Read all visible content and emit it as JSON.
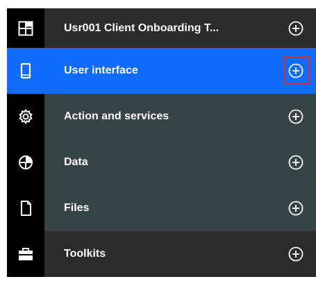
{
  "nav": {
    "items": [
      {
        "label": "Usr001 Client Onboarding T...",
        "icon": "dashboard-icon",
        "variant": "header"
      },
      {
        "label": "User interface",
        "icon": "mobile-device-icon",
        "variant": "active"
      },
      {
        "label": "Action and services",
        "icon": "gear-icon",
        "variant": "body"
      },
      {
        "label": "Data",
        "icon": "pie-chart-icon",
        "variant": "body"
      },
      {
        "label": "Files",
        "icon": "document-icon",
        "variant": "body"
      },
      {
        "label": "Toolkits",
        "icon": "toolbox-icon",
        "variant": "footer"
      }
    ],
    "add_icon": "add-circle-icon",
    "colors": {
      "rail": "#000000",
      "active": "#0f6cfd",
      "body": "#364544",
      "header": "#2c2c2c",
      "highlight_border": "#e02a2a",
      "text": "#ffffff"
    }
  }
}
